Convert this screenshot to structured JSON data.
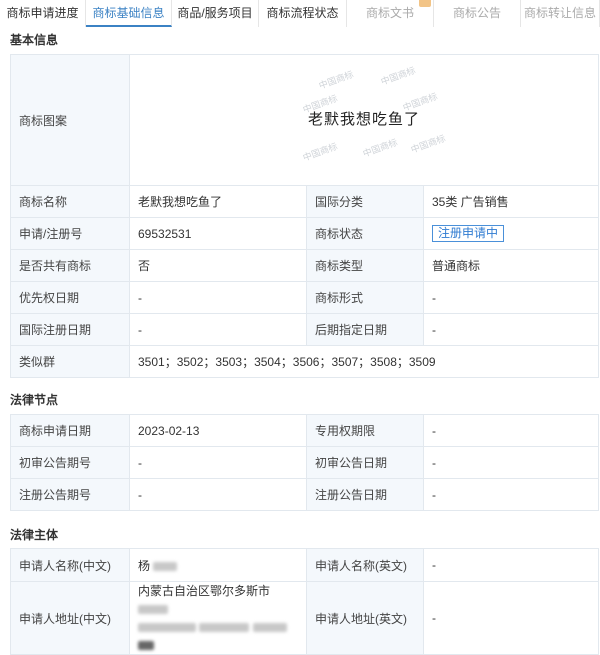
{
  "tabs": [
    {
      "label": "商标申请进度",
      "state": "normal"
    },
    {
      "label": "商标基础信息",
      "state": "active"
    },
    {
      "label": "商品/服务项目",
      "state": "normal"
    },
    {
      "label": "商标流程状态",
      "state": "normal"
    },
    {
      "label": "商标文书",
      "state": "disabled"
    },
    {
      "label": "商标公告",
      "state": "disabled"
    },
    {
      "label": "商标转让信息",
      "state": "disabled"
    }
  ],
  "basic": {
    "section_title": "基本信息",
    "mark_image_label": "商标图案",
    "mark_image_text": "老默我想吃鱼了",
    "watermark": "中国商标",
    "rows": [
      {
        "l1": "商标名称",
        "v1": "老默我想吃鱼了",
        "l2": "国际分类",
        "v2": "35类 广告销售"
      },
      {
        "l1": "申请/注册号",
        "v1": "69532531",
        "l2": "商标状态",
        "v2": "注册申请中"
      },
      {
        "l1": "是否共有商标",
        "v1": "否",
        "l2": "商标类型",
        "v2": "普通商标"
      },
      {
        "l1": "优先权日期",
        "v1": "-",
        "l2": "商标形式",
        "v2": "-"
      },
      {
        "l1": "国际注册日期",
        "v1": "-",
        "l2": "后期指定日期",
        "v2": "-"
      }
    ],
    "similar_label": "类似群",
    "similar_value": "3501；3502；3503；3504；3506；3507；3508；3509"
  },
  "legal": {
    "section_title": "法律节点",
    "rows": [
      {
        "l1": "商标申请日期",
        "v1": "2023-02-13",
        "l2": "专用权期限",
        "v2": "-"
      },
      {
        "l1": "初审公告期号",
        "v1": "-",
        "l2": "初审公告日期",
        "v2": "-"
      },
      {
        "l1": "注册公告期号",
        "v1": "-",
        "l2": "注册公告日期",
        "v2": "-"
      }
    ]
  },
  "subject": {
    "section_title": "法律主体",
    "name_cn_label": "申请人名称(中文)",
    "name_cn_value": "杨",
    "name_en_label": "申请人名称(英文)",
    "name_en_value": "-",
    "addr_cn_label": "申请人地址(中文)",
    "addr_cn_value": "内蒙古自治区鄂尔多斯市",
    "addr_en_label": "申请人地址(英文)",
    "addr_en_value": "-"
  }
}
